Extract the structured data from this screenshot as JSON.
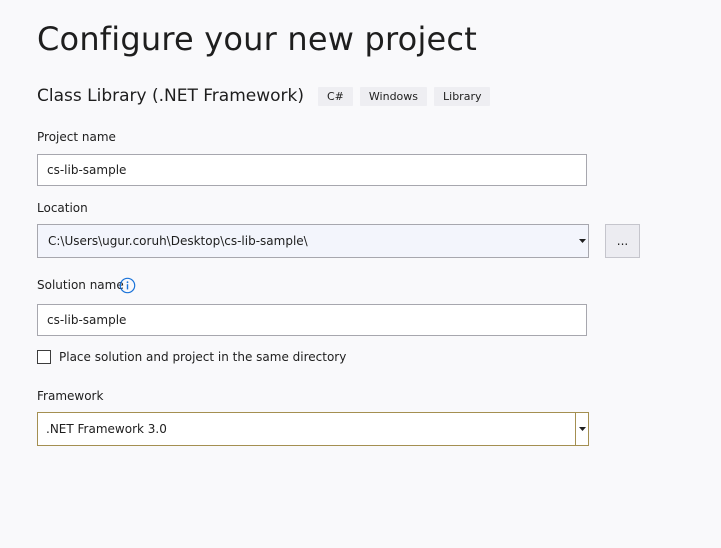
{
  "page": {
    "title": "Configure your new project"
  },
  "template": {
    "name": "Class Library (.NET Framework)",
    "tags": [
      "C#",
      "Windows",
      "Library"
    ]
  },
  "project_name": {
    "label": "Project name",
    "value": "cs-lib-sample"
  },
  "location": {
    "label": "Location",
    "value": "C:\\Users\\ugur.coruh\\Desktop\\cs-lib-sample\\",
    "browse_label": "..."
  },
  "solution_name": {
    "label": "Solution name",
    "value": "cs-lib-sample",
    "info_icon": "info-icon"
  },
  "same_directory": {
    "label": "Place solution and project in the same directory",
    "checked": false
  },
  "framework": {
    "label": "Framework",
    "value": ".NET Framework 3.0"
  },
  "colors": {
    "accent": "#1a73d9",
    "focus_border": "#a48f51",
    "background": "#f9f9fb"
  }
}
